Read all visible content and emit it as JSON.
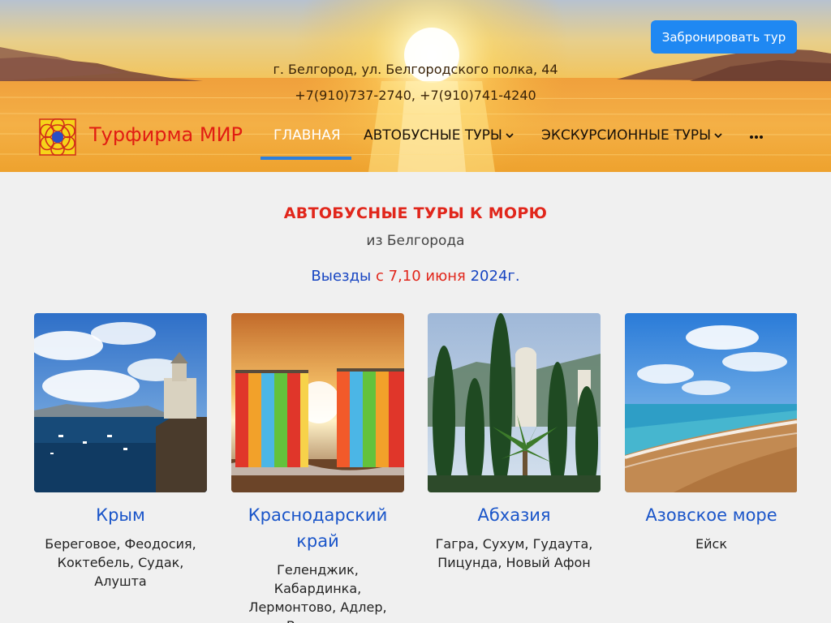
{
  "header": {
    "book_button": "Забронировать тур",
    "address": "г. Белгород, ул. Белгородского полка, 44",
    "phones": "+7(910)737-2740, +7(910)741-4240",
    "brand": "Турфирма МИР",
    "logo_icon": "sun-star-logo-icon"
  },
  "nav": {
    "items": [
      {
        "label": "ГЛАВНАЯ",
        "active": true
      },
      {
        "label": "АВТОБУСНЫЕ ТУРЫ",
        "has_dropdown": true
      },
      {
        "label": "ЭКСКУРСИОННЫЕ ТУРЫ",
        "has_dropdown": true
      }
    ],
    "more_icon": "more-dots-icon"
  },
  "main": {
    "title": "АВТОБУСНЫЕ ТУРЫ К МОРЮ",
    "subtitle": "из Белгорода",
    "departures_prefix": "Выезды",
    "departures_dates": "с 7,10 июня",
    "departures_suffix": "2024г."
  },
  "cards": [
    {
      "title": "Крым",
      "places": "Береговое, Феодосия, Коктебель, Судак, Алушта",
      "image": "crimea-castle-sea-photo"
    },
    {
      "title": "Краснодарский край",
      "places": "Геленджик, Кабардинка, Лермонтово, Адлер, Вардане, Новомихайловка, Анапа",
      "image": "beach-chairs-sunset-photo"
    },
    {
      "title": "Абхазия",
      "places": "Гагра, Сухум, Гудаута, Пицунда, Новый Афон",
      "image": "abkhazia-cypress-palm-photo"
    },
    {
      "title": "Азовское море",
      "places": "Ейск",
      "image": "azov-sea-beach-photo"
    }
  ],
  "colors": {
    "accent_red": "#e1261b",
    "link_blue": "#1a55c9",
    "button_blue": "#1f88f2",
    "nav_underline": "#2b7fde"
  }
}
